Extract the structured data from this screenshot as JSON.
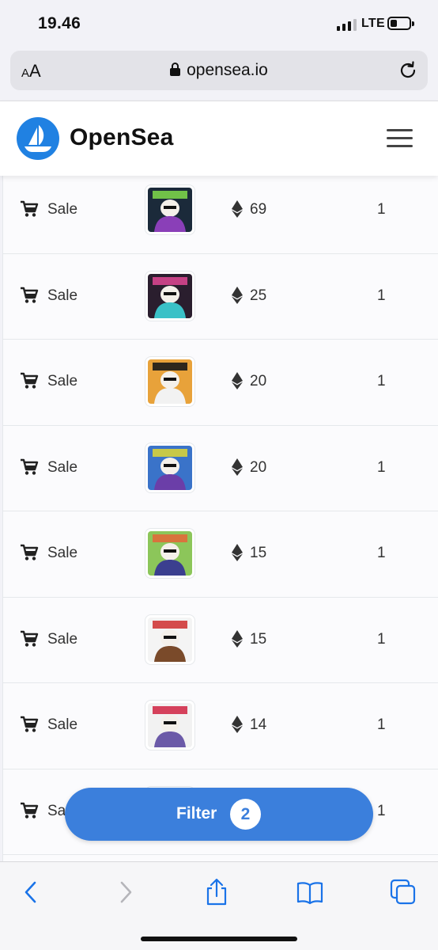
{
  "status_bar": {
    "time": "19.46",
    "network": "LTE"
  },
  "browser": {
    "text_size_label_small": "A",
    "text_size_label_large": "A",
    "url": "opensea.io"
  },
  "site": {
    "brand": "OpenSea"
  },
  "rows": [
    {
      "event": "Sale",
      "price": "69",
      "quantity": "1"
    },
    {
      "event": "Sale",
      "price": "25",
      "quantity": "1"
    },
    {
      "event": "Sale",
      "price": "20",
      "quantity": "1"
    },
    {
      "event": "Sale",
      "price": "20",
      "quantity": "1"
    },
    {
      "event": "Sale",
      "price": "15",
      "quantity": "1"
    },
    {
      "event": "Sale",
      "price": "15",
      "quantity": "1"
    },
    {
      "event": "Sale",
      "price": "14",
      "quantity": "1"
    },
    {
      "event": "Sa",
      "price": "",
      "quantity": "1"
    }
  ],
  "filter": {
    "label": "Filter",
    "count": "2"
  },
  "colors": {
    "accent": "#2081e2",
    "filter_button": "#3b7fdc",
    "ios_blue": "#1a73e8"
  },
  "icons": [
    "cart-icon",
    "ethereum-icon",
    "back-icon",
    "forward-icon",
    "share-icon",
    "bookmarks-icon",
    "tabs-icon",
    "reload-icon",
    "lock-icon",
    "menu-icon"
  ]
}
